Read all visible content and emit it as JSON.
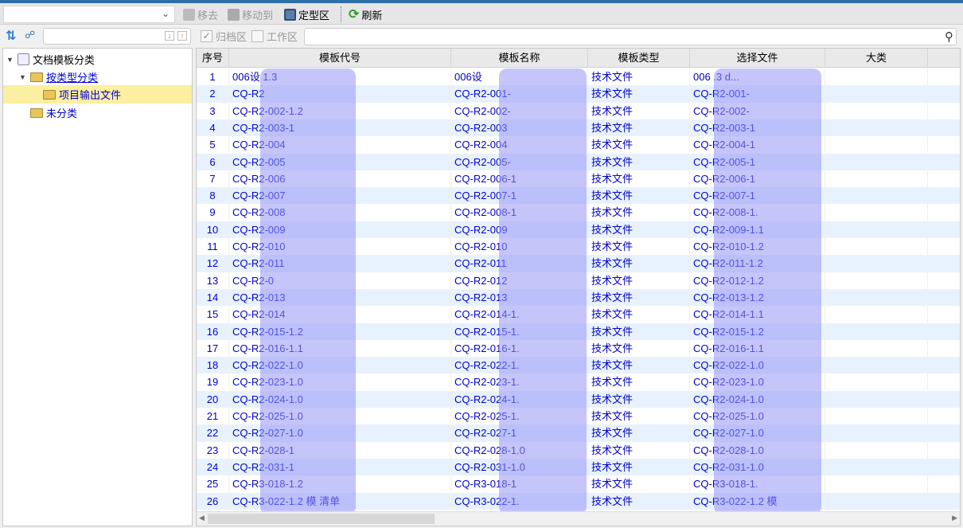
{
  "toolbar": {
    "combo_value": "",
    "remove": "移去",
    "move_to": "移动到",
    "fixed_area": "定型区",
    "refresh": "刷新"
  },
  "toolbar2": {
    "archive": "归档区",
    "archive_checked": true,
    "work": "工作区",
    "work_checked": false,
    "search_value": ""
  },
  "tree": [
    {
      "label": "文档模板分类"
    },
    {
      "label": "按类型分类"
    },
    {
      "label": "项目输出文件"
    },
    {
      "label": "未分类"
    }
  ],
  "columns": [
    "序号",
    "模板代号",
    "模板名称",
    "模板类型",
    "选择文件",
    "大类",
    ""
  ],
  "rows": [
    [
      "1",
      "006设 1.3",
      "006设",
      "技术文件",
      "006 .3 d..."
    ],
    [
      "2",
      "CQ-R2",
      "CQ-R2-001-",
      "技术文件",
      "CQ-R2-001-"
    ],
    [
      "3",
      "CQ-R2-002-1.2",
      "CQ-R2-002-",
      "技术文件",
      "CQ-R2-002-"
    ],
    [
      "4",
      "CQ-R2-003-1",
      "CQ-R2-003",
      "技术文件",
      "CQ-R2-003-1"
    ],
    [
      "5",
      "CQ-R2-004",
      "CQ-R2-004",
      "技术文件",
      "CQ-R2-004-1"
    ],
    [
      "6",
      "CQ-R2-005",
      "CQ-R2-005-",
      "技术文件",
      "CQ-R2-005-1"
    ],
    [
      "7",
      "CQ-R2-006",
      "CQ-R2-006-1",
      "技术文件",
      "CQ-R2-006-1"
    ],
    [
      "8",
      "CQ-R2-007",
      "CQ-R2-007-1",
      "技术文件",
      "CQ-R2-007-1"
    ],
    [
      "9",
      "CQ-R2-008",
      "CQ-R2-008-1",
      "技术文件",
      "CQ-R2-008-1."
    ],
    [
      "10",
      "CQ-R2-009",
      "CQ-R2-009",
      "技术文件",
      "CQ-R2-009-1.1"
    ],
    [
      "11",
      "CQ-R2-010",
      "CQ-R2-010",
      "技术文件",
      "CQ-R2-010-1.2"
    ],
    [
      "12",
      "CQ-R2-011",
      "CQ-R2-011",
      "技术文件",
      "CQ-R2-011-1.2"
    ],
    [
      "13",
      "CQ-R2-0",
      "CQ-R2-012",
      "技术文件",
      "CQ-R2-012-1.2"
    ],
    [
      "14",
      "CQ-R2-013",
      "CQ-R2-013",
      "技术文件",
      "CQ-R2-013-1.2"
    ],
    [
      "15",
      "CQ-R2-014",
      "CQ-R2-014-1.",
      "技术文件",
      "CQ-R2-014-1.1"
    ],
    [
      "16",
      "CQ-R2-015-1.2",
      "CQ-R2-015-1.",
      "技术文件",
      "CQ-R2-015-1.2"
    ],
    [
      "17",
      "CQ-R2-016-1.1",
      "CQ-R2-016-1.",
      "技术文件",
      "CQ-R2-016-1.1"
    ],
    [
      "18",
      "CQ-R2-022-1.0",
      "CQ-R2-022-1.",
      "技术文件",
      "CQ-R2-022-1.0"
    ],
    [
      "19",
      "CQ-R2-023-1.0",
      "CQ-R2-023-1.",
      "技术文件",
      "CQ-R2-023-1.0"
    ],
    [
      "20",
      "CQ-R2-024-1.0",
      "CQ-R2-024-1.",
      "技术文件",
      "CQ-R2-024-1.0"
    ],
    [
      "21",
      "CQ-R2-025-1.0",
      "CQ-R2-025-1.",
      "技术文件",
      "CQ-R2-025-1.0"
    ],
    [
      "22",
      "CQ-R2-027-1.0",
      "CQ-R2-027-1",
      "技术文件",
      "CQ-R2-027-1.0"
    ],
    [
      "23",
      "CQ-R2-028-1",
      "CQ-R2-028-1.0",
      "技术文件",
      "CQ-R2-028-1.0"
    ],
    [
      "24",
      "CQ-R2-031-1",
      "CQ-R2-031-1.0",
      "技术文件",
      "CQ-R2-031-1.0"
    ],
    [
      "25",
      "CQ-R3-018-1.2",
      "CQ-R3-018-1",
      "技术文件",
      "CQ-R3-018-1."
    ],
    [
      "26",
      "CQ-R3-022-1.2 模 清单",
      "CQ-R3-022-1.",
      "技术文件",
      "CQ-R3-022-1.2 模"
    ]
  ],
  "colors": {
    "link": "#0000cc",
    "alt_row": "#e8f2ff",
    "selected": "#fcefa1"
  }
}
